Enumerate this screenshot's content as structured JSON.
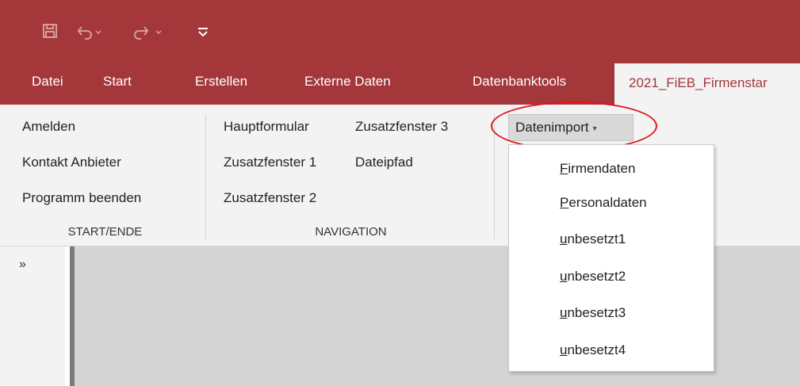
{
  "quick_access": {
    "icons": [
      "save-icon",
      "undo-icon",
      "redo-icon",
      "customize-icon"
    ]
  },
  "tabs": [
    "Datei",
    "Start",
    "Erstellen",
    "Externe Daten",
    "Datenbanktools"
  ],
  "active_tab": "2021_FiEB_Firmenstar",
  "ribbon": {
    "start_ende": {
      "buttons": [
        "Amelden",
        "Kontakt Anbieter",
        "Programm beenden"
      ],
      "label": "START/ENDE"
    },
    "navigation": {
      "buttons": [
        "Hauptformular",
        "Zusatzfenster 3",
        "Zusatzfenster 1",
        "Dateipfad",
        "Zusatzfenster 2"
      ],
      "label": "NAVIGATION"
    },
    "datenimport": {
      "label": "Datenimport",
      "menu": [
        {
          "acc": "F",
          "rest": "irmendaten"
        },
        {
          "acc": "P",
          "rest": "ersonaldaten"
        },
        {
          "acc": "u",
          "rest": "nbesetzt1"
        },
        {
          "acc": "u",
          "rest": "nbesetzt2"
        },
        {
          "acc": "u",
          "rest": "nbesetzt3"
        },
        {
          "acc": "u",
          "rest": "nbesetzt4"
        }
      ]
    }
  },
  "nav_pane": {
    "expand_label": "»"
  },
  "colors": {
    "title_bar": "#a4373a",
    "annotation": "#e0121a"
  }
}
